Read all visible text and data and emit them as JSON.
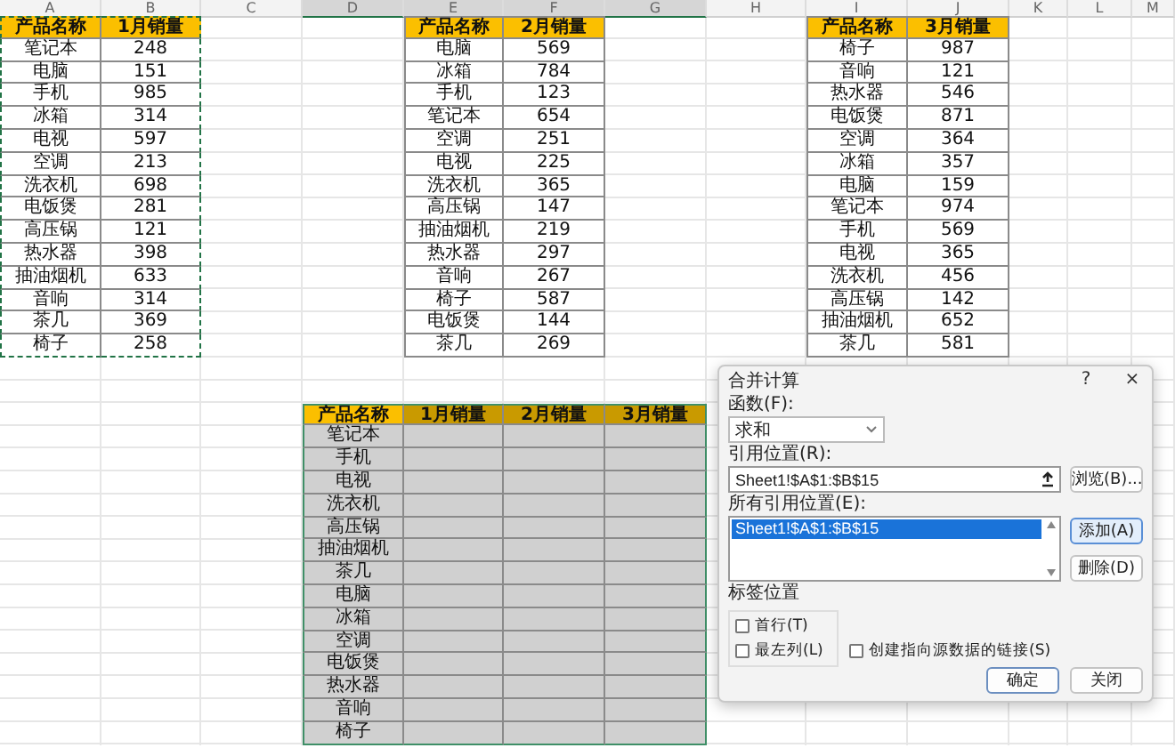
{
  "column_headers": [
    {
      "label": "A",
      "selected": false
    },
    {
      "label": "B",
      "selected": false
    },
    {
      "label": "C",
      "selected": false
    },
    {
      "label": "D",
      "selected": true
    },
    {
      "label": "E",
      "selected": true
    },
    {
      "label": "F",
      "selected": true
    },
    {
      "label": "G",
      "selected": true
    },
    {
      "label": "H",
      "selected": false
    },
    {
      "label": "I",
      "selected": false
    },
    {
      "label": "J",
      "selected": false
    },
    {
      "label": "K",
      "selected": false
    },
    {
      "label": "L",
      "selected": false
    },
    {
      "label": "M",
      "selected": false
    }
  ],
  "source_tables": [
    {
      "copy_marquee": true,
      "columns": [
        "产品名称",
        "1月销量"
      ],
      "rows": [
        [
          "笔记本",
          "248"
        ],
        [
          "电脑",
          "151"
        ],
        [
          "手机",
          "985"
        ],
        [
          "冰箱",
          "314"
        ],
        [
          "电视",
          "597"
        ],
        [
          "空调",
          "213"
        ],
        [
          "洗衣机",
          "698"
        ],
        [
          "电饭煲",
          "281"
        ],
        [
          "高压锅",
          "121"
        ],
        [
          "热水器",
          "398"
        ],
        [
          "抽油烟机",
          "633"
        ],
        [
          "音响",
          "314"
        ],
        [
          "茶几",
          "369"
        ],
        [
          "椅子",
          "258"
        ]
      ]
    },
    {
      "copy_marquee": false,
      "columns": [
        "产品名称",
        "2月销量"
      ],
      "rows": [
        [
          "电脑",
          "569"
        ],
        [
          "冰箱",
          "784"
        ],
        [
          "手机",
          "123"
        ],
        [
          "笔记本",
          "654"
        ],
        [
          "空调",
          "251"
        ],
        [
          "电视",
          "225"
        ],
        [
          "洗衣机",
          "365"
        ],
        [
          "高压锅",
          "147"
        ],
        [
          "抽油烟机",
          "219"
        ],
        [
          "热水器",
          "297"
        ],
        [
          "音响",
          "267"
        ],
        [
          "椅子",
          "587"
        ],
        [
          "电饭煲",
          "144"
        ],
        [
          "茶几",
          "269"
        ]
      ]
    },
    {
      "copy_marquee": false,
      "columns": [
        "产品名称",
        "3月销量"
      ],
      "rows": [
        [
          "椅子",
          "987"
        ],
        [
          "音响",
          "121"
        ],
        [
          "热水器",
          "546"
        ],
        [
          "电饭煲",
          "871"
        ],
        [
          "空调",
          "364"
        ],
        [
          "冰箱",
          "357"
        ],
        [
          "电脑",
          "159"
        ],
        [
          "笔记本",
          "974"
        ],
        [
          "手机",
          "569"
        ],
        [
          "电视",
          "365"
        ],
        [
          "洗衣机",
          "456"
        ],
        [
          "高压锅",
          "142"
        ],
        [
          "抽油烟机",
          "652"
        ],
        [
          "茶几",
          "581"
        ]
      ]
    }
  ],
  "summary_table": {
    "selected": true,
    "columns": [
      "产品名称",
      "1月销量",
      "2月销量",
      "3月销量"
    ],
    "rows": [
      "笔记本",
      "手机",
      "电视",
      "洗衣机",
      "高压锅",
      "抽油烟机",
      "茶几",
      "电脑",
      "冰箱",
      "空调",
      "电饭煲",
      "热水器",
      "音响",
      "椅子"
    ]
  },
  "dialog": {
    "title": "合并计算",
    "help": "?",
    "close": "×",
    "function_label": "函数(F):",
    "function_value": "求和",
    "reference_label": "引用位置(R):",
    "reference_value": "Sheet1!$A$1:$B$15",
    "browse_button": "浏览(B)...",
    "all_references_label": "所有引用位置(E):",
    "all_references": [
      {
        "text": "Sheet1!$A$1:$B$15",
        "selected": true
      }
    ],
    "side_buttons": [
      {
        "label": "添加(A)",
        "kind": "focused"
      },
      {
        "label": "删除(D)",
        "kind": "normal"
      }
    ],
    "label_group_title": "标签位置",
    "checkboxes": [
      {
        "label": "首行(T)",
        "checked": false
      },
      {
        "label": "最左列(L)",
        "checked": false
      },
      {
        "label": "创建指向源数据的链接(S)",
        "checked": false
      }
    ],
    "footer_buttons": [
      {
        "label": "确定",
        "kind": "default"
      },
      {
        "label": "关闭",
        "kind": "normal"
      }
    ]
  }
}
